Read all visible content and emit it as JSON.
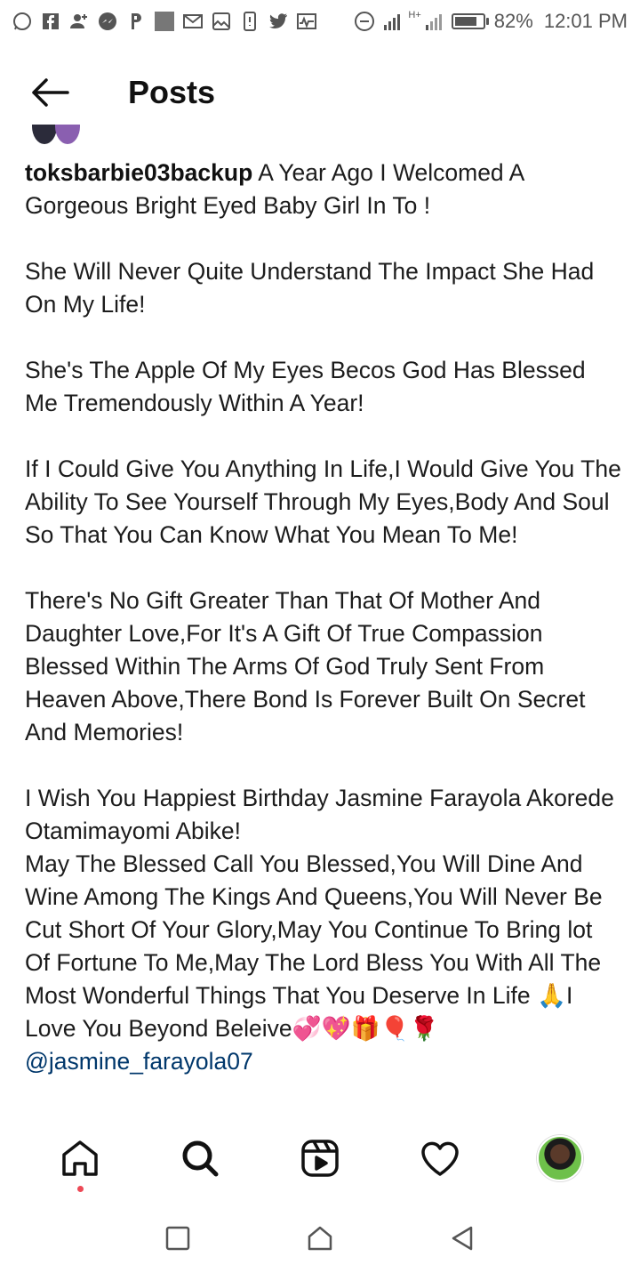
{
  "status_bar": {
    "battery": "82%",
    "time": "12:01 PM",
    "network": "H+",
    "left_icons": [
      "whatsapp-icon",
      "facebook-icon",
      "add-user-icon",
      "messenger-icon",
      "pinterest-icon",
      "app-icon",
      "gmail-icon",
      "gallery-icon",
      "sim-icon",
      "twitter-icon",
      "activity-icon"
    ]
  },
  "header": {
    "title": "Posts"
  },
  "post": {
    "username": "toksbarbie03backup",
    "paragraphs": [
      "A Year Ago I Welcomed A Gorgeous Bright Eyed Baby Girl In To !",
      "She Will Never Quite Understand The Impact She Had On My Life!",
      "She's The Apple Of My Eyes Becos God Has Blessed Me Tremendously Within A Year!",
      "If I Could Give You Anything In Life,I Would Give You The Ability To See Yourself Through My Eyes,Body And Soul So That You Can Know What You Mean To Me!",
      "There's No Gift Greater Than That Of Mother And Daughter Love,For It's A Gift Of True Compassion Blessed Within The Arms Of God Truly Sent From Heaven Above,There Bond Is Forever Built On Secret And Memories!"
    ],
    "closing_1": "I Wish You Happiest Birthday Jasmine Farayola Akorede Otamimayomi Abike!",
    "closing_2": "May The Blessed Call You Blessed,You Will Dine And Wine Among The Kings And Queens,You Will Never Be Cut Short Of Your Glory,May You Continue To Bring lot Of Fortune To Me,May The Lord Bless You With All The Most Wonderful Things That You Deserve In Life",
    "emoji_prefix": "🙏",
    "closing_3": "I Love You Beyond Beleive",
    "emoji_suffix": "💞💖🎁🎈🌹",
    "mention": "@jasmine_farayola07"
  },
  "bottom_nav": [
    "home-icon",
    "search-icon",
    "reels-icon",
    "heart-icon",
    "profile-avatar"
  ],
  "system_nav": [
    "recents-button",
    "home-button",
    "back-button"
  ],
  "colors": {
    "notification_dot": "#ed4956",
    "mention": "#00376b"
  }
}
